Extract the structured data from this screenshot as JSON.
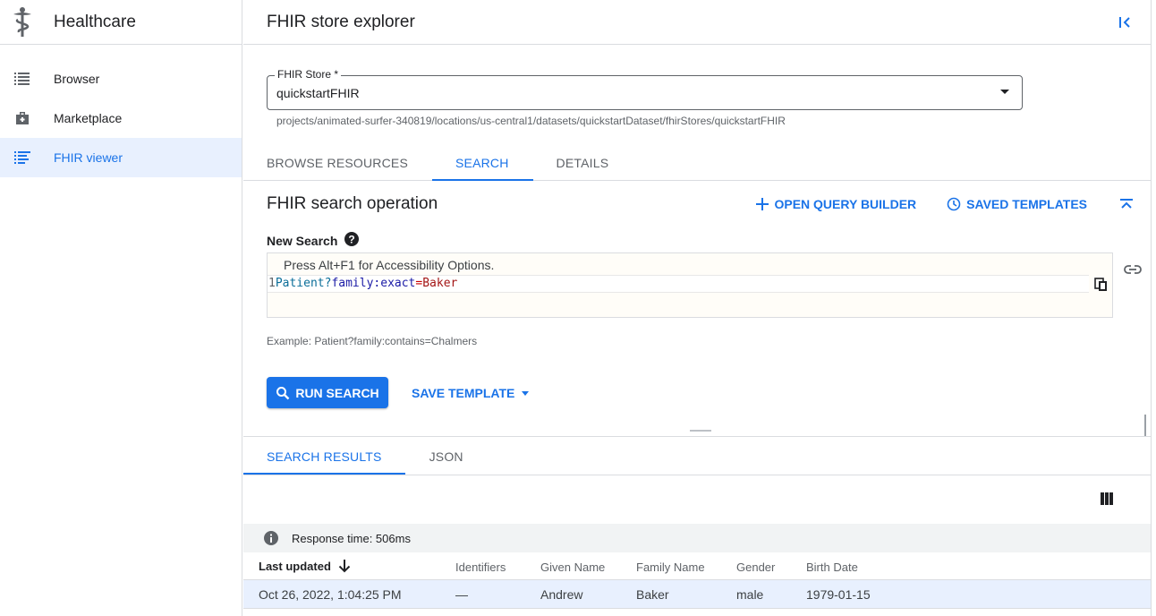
{
  "sidebar": {
    "title": "Healthcare",
    "items": [
      {
        "label": "Browser",
        "icon": "list-icon"
      },
      {
        "label": "Marketplace",
        "icon": "bag-icon"
      },
      {
        "label": "FHIR viewer",
        "icon": "fhir-list-icon",
        "active": true
      }
    ]
  },
  "header": {
    "title": "FHIR store explorer"
  },
  "store": {
    "label": "FHIR Store *",
    "value": "quickstartFHIR",
    "path": "projects/animated-surfer-340819/locations/us-central1/datasets/quickstartDataset/fhirStores/quickstartFHIR"
  },
  "tabs": [
    {
      "label": "BROWSE RESOURCES",
      "active": false
    },
    {
      "label": "SEARCH",
      "active": true
    },
    {
      "label": "DETAILS",
      "active": false
    }
  ],
  "search": {
    "title": "FHIR search operation",
    "open_query_builder": "OPEN QUERY BUILDER",
    "saved_templates": "SAVED TEMPLATES",
    "new_search_label": "New Search",
    "editor_hint": "Press Alt+F1 for Accessibility Options.",
    "line_number": "1",
    "query_tokens": {
      "resource": "Patient?",
      "param": "family",
      "colon": ":",
      "modifier": "exact",
      "equals": "=",
      "value": "Baker"
    },
    "example": "Example: Patient?family:contains=Chalmers",
    "run_label": "RUN SEARCH",
    "save_template_label": "SAVE TEMPLATE"
  },
  "results": {
    "tabs": [
      {
        "label": "SEARCH RESULTS",
        "active": true
      },
      {
        "label": "JSON",
        "active": false
      }
    ],
    "response_time": "Response time: 506ms",
    "columns": [
      "Last updated",
      "Identifiers",
      "Given Name",
      "Family Name",
      "Gender",
      "Birth Date"
    ],
    "rows": [
      {
        "last_updated": "Oct 26, 2022, 1:04:25 PM",
        "identifiers": "—",
        "given": "Andrew",
        "family": "Baker",
        "gender": "male",
        "birth": "1979-01-15"
      }
    ]
  },
  "colors": {
    "accent": "#1a73e8",
    "active_bg": "#e8f0fe",
    "border": "#dadce0"
  }
}
